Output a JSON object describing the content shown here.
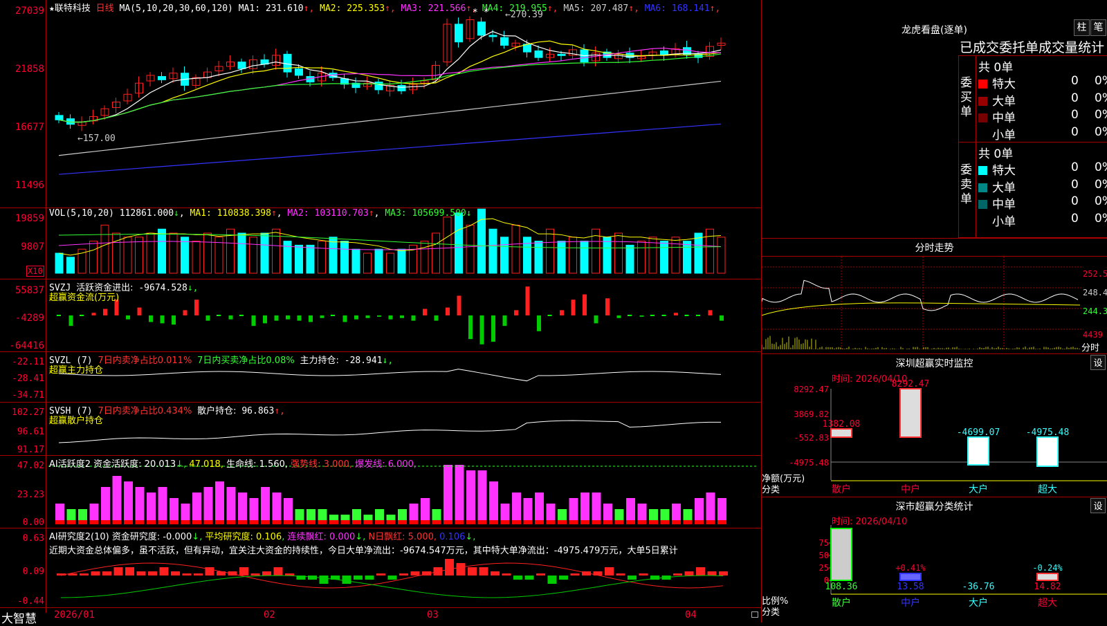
{
  "app": {
    "brand": "大智慧"
  },
  "kline": {
    "title_prefix": "★",
    "stock": "联特科技",
    "period": "日线",
    "ma_spec": "MA(5,10,20,30,60,120)",
    "ma": [
      {
        "label": "MA1:",
        "value": "231.610",
        "color": "#ffffff"
      },
      {
        "label": "MA2:",
        "value": "225.353",
        "color": "#ffff00"
      },
      {
        "label": "MA3:",
        "value": "221.566",
        "color": "#ff33ff"
      },
      {
        "label": "MA4:",
        "value": "219.955",
        "color": "#33ff33"
      },
      {
        "label": "MA5:",
        "value": "207.487",
        "color": "#cccccc"
      },
      {
        "label": "MA6:",
        "value": "168.141",
        "color": "#3333ff"
      }
    ],
    "arrow": "↑",
    "y_labels": [
      "27039",
      "21858",
      "16677",
      "11496"
    ],
    "high_note": "270.39",
    "low_note": "157.00",
    "high_marks": "* *"
  },
  "vol": {
    "spec": "VOL(5,10,20)",
    "value": "112861.000",
    "down": "↓",
    "up": "↑",
    "ma1": "110838.398",
    "ma2": "103110.703",
    "ma3": "105699.500",
    "ma1_label": "MA1:",
    "ma2_label": "MA2:",
    "ma3_label": "MA3:",
    "y_labels": [
      "19859",
      "9807"
    ],
    "unit": "X10"
  },
  "svzj": {
    "label": "SVZJ",
    "text": "活跃资金进出:",
    "value": "-9674.528",
    "arrow": "↓,",
    "sub": "超赢资金流(万元)",
    "y_labels": [
      "55837",
      "-4289",
      "-64416"
    ]
  },
  "svzl": {
    "spec": "SVZL (7)",
    "t1": "7日内卖净占比0.011%",
    "t2": "7日内买卖净占比0.08%",
    "t3": "主力持仓:",
    "value": "-28.941",
    "arrow": "↓,",
    "sub": "超赢主力持仓",
    "y_labels": [
      "-22.11",
      "-28.41",
      "-34.71"
    ]
  },
  "svsh": {
    "spec": "SVSH (7)",
    "t1": "7日内卖净占比0.434%",
    "t2": "散户持仓:",
    "value": "96.863",
    "arrow": "↑,",
    "sub": "超赢散户持仓",
    "y_labels": [
      "102.27",
      "96.61",
      "91.17"
    ]
  },
  "ai1": {
    "spec": "AI活跃度2",
    "t1": "资金活跃度:",
    "v1": "20.013",
    "v2": "47.018,",
    "t3": "生命线:",
    "v3": "1.560,",
    "t4": "强势线:",
    "v4": "3.000,",
    "t5": "爆发线:",
    "v5": "6.000,",
    "arrow_down": "↓,",
    "y_labels": [
      "47.02",
      "23.23",
      "0.00"
    ]
  },
  "ai2": {
    "spec": "AI研究度2(10)",
    "t1": "资金研究度:",
    "v1": "-0.000",
    "t2": "平均研究度:",
    "v2": "0.106",
    "t3": "连续飘红:",
    "v3": "0.000",
    "t4": "N日飘红:",
    "v4": "5.000,",
    "v5": "0.106",
    "arrow": "↓,",
    "comment": "近期大资金总体偏多，虽不活跃，但有异动，宜关注大资金的持续性，今日大单净流出：-9674.547万元，其中特大单净流出：-4975.479万元，大单5日累计",
    "y_labels": [
      "0.63",
      "0.09",
      "-0.44"
    ]
  },
  "xaxis": [
    "2026/01",
    "02",
    "03",
    "04"
  ],
  "lhb": {
    "title": "龙虎看盘(逐单)",
    "btn1": "柱",
    "btn2": "笔",
    "tabs": "已成交委托单成交量统计",
    "buy_label": "委买单",
    "sell_label": "委卖单",
    "buy_total": "共 0单",
    "sell_total": "共 0单",
    "buy_rows": [
      {
        "name": "特大",
        "v": "0",
        "p": "0%",
        "color": "#ff0000"
      },
      {
        "name": "大单",
        "v": "0",
        "p": "0%",
        "color": "#990000"
      },
      {
        "name": "中单",
        "v": "0",
        "p": "0%",
        "color": "#770000"
      },
      {
        "name": "小单",
        "v": "0",
        "p": "0%",
        "color": ""
      }
    ],
    "sell_rows": [
      {
        "name": "特大",
        "v": "0",
        "p": "0%",
        "color": "#00ffff"
      },
      {
        "name": "大单",
        "v": "0",
        "p": "0%",
        "color": "#008888"
      },
      {
        "name": "中单",
        "v": "0",
        "p": "0%",
        "color": "#006666"
      },
      {
        "name": "小单",
        "v": "0",
        "p": "0%",
        "color": ""
      }
    ]
  },
  "fenshi": {
    "title": "分时走势",
    "y_labels": [
      "252.5",
      "248.4",
      "244.3"
    ],
    "vol_label": "4439",
    "vol_unit": "分时"
  },
  "sz_monitor": {
    "title": "深圳超赢实时监控",
    "btn": "设",
    "time": "时间: 2026/04/10",
    "y_labels": [
      "8292.47",
      "3869.82",
      "-552.83",
      "-4975.48"
    ],
    "ylabel": "净额(万元)",
    "xlabel": "分类",
    "bars": [
      {
        "name": "散户",
        "value": "1382.08"
      },
      {
        "name": "中户",
        "value": "8292.47"
      },
      {
        "name": "大户",
        "value": "-4699.07"
      },
      {
        "name": "超大",
        "value": "-4975.48"
      }
    ]
  },
  "sz_stats": {
    "title": "深市超赢分类统计",
    "btn": "设",
    "time": "时间: 2026/04/10",
    "y_labels": [
      "75",
      "50",
      "25",
      "0"
    ],
    "ylabel": "比例%",
    "xlabel": "分类",
    "bars": [
      {
        "name": "散户",
        "value": "108.36",
        "pct": ""
      },
      {
        "name": "中户",
        "value": "13.58",
        "pct": "+0.41%"
      },
      {
        "name": "大户",
        "value": "-36.76",
        "pct": ""
      },
      {
        "name": "超大",
        "value": "14.82",
        "pct": "-0.24%"
      }
    ]
  }
}
